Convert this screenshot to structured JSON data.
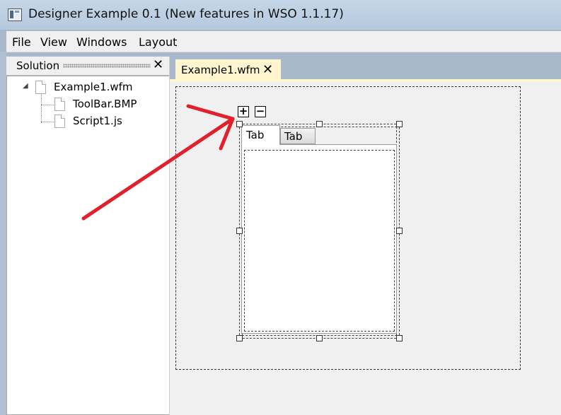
{
  "window": {
    "title": "Designer Example 0.1 (New features in WSO 1.1.17)",
    "icon": "app-window-icon"
  },
  "menu": {
    "items": [
      "File",
      "View",
      "Windows",
      "Layout"
    ]
  },
  "solution": {
    "title": "Solution",
    "close_icon": "close-icon",
    "tree": {
      "root": {
        "label": "Example1.wfm",
        "expanded": true
      },
      "children": [
        {
          "label": "ToolBar.BMP"
        },
        {
          "label": "Script1.js"
        }
      ]
    }
  },
  "document_tab": {
    "label": "Example1.wfm",
    "close_icon": "close-icon"
  },
  "designer": {
    "tool_buttons": {
      "add": "+",
      "remove": "−"
    },
    "tabs": [
      {
        "label": "Tab",
        "selected": true
      },
      {
        "label": "Tab",
        "selected": false
      }
    ]
  },
  "colors": {
    "doc_tab_background": "#fff6cf",
    "annotation_arrow": "#e0202a"
  }
}
